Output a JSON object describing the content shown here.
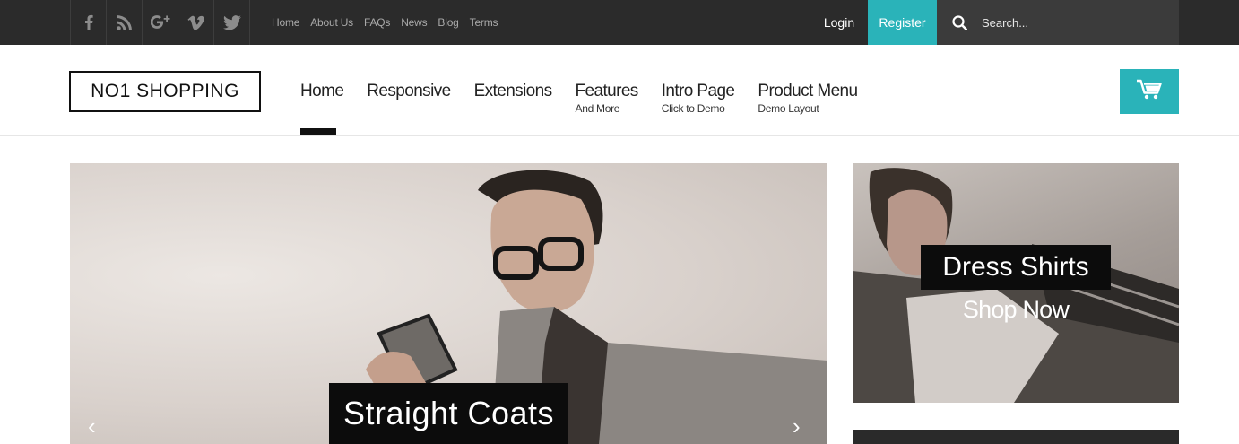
{
  "topbar": {
    "social": [
      "facebook-icon",
      "rss-icon",
      "google-plus-icon",
      "vimeo-icon",
      "twitter-icon"
    ],
    "links": [
      "Home",
      "About Us",
      "FAQs",
      "News",
      "Blog",
      "Terms"
    ],
    "login_label": "Login",
    "register_label": "Register",
    "search_placeholder": "Search..."
  },
  "header": {
    "logo": "NO1 SHOPPING",
    "nav": [
      {
        "label": "Home",
        "sub": ""
      },
      {
        "label": "Responsive",
        "sub": ""
      },
      {
        "label": "Extensions",
        "sub": ""
      },
      {
        "label": "Features",
        "sub": "And More"
      },
      {
        "label": "Intro Page",
        "sub": "Click to Demo"
      },
      {
        "label": "Product Menu",
        "sub": "Demo Layout"
      }
    ],
    "cart_icon": "cart-icon"
  },
  "slider": {
    "caption": "Straight Coats",
    "prev_icon": "chevron-left-icon",
    "next_icon": "chevron-right-icon"
  },
  "side_banner": {
    "title": "Dress Shirts",
    "cta": "Shop Now"
  },
  "colors": {
    "accent": "#2ab3b9",
    "topbar": "#2b2b2b"
  }
}
